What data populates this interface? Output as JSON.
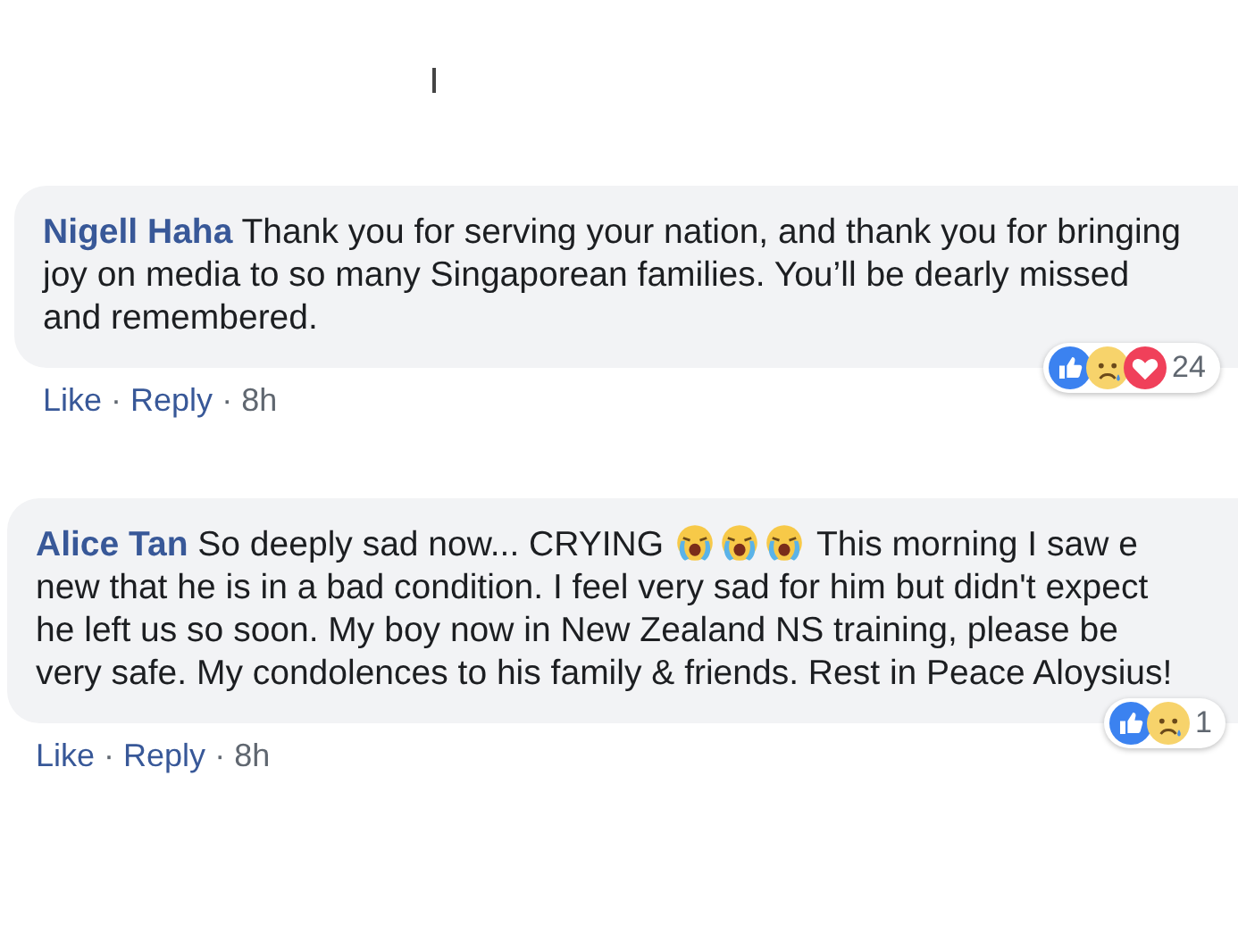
{
  "comments": [
    {
      "author": "Nigell Haha",
      "segments": [
        {
          "kind": "text",
          "text": "Thank you for serving your nation, and thank you for bringing joy on media to so many Singaporean families. You’ll be dearly missed and remembered."
        }
      ],
      "actions": [
        {
          "label": "Like"
        },
        {
          "label": "Reply"
        }
      ],
      "separator": "·",
      "time": "8h",
      "reactions": [
        {
          "kind": "like"
        },
        {
          "kind": "sad"
        },
        {
          "kind": "love"
        }
      ],
      "reaction_count": "24"
    },
    {
      "author": "Alice Tan",
      "segments": [
        {
          "kind": "text",
          "text": "So deeply sad now... CRYING"
        },
        {
          "kind": "crying"
        },
        {
          "kind": "crying"
        },
        {
          "kind": "crying"
        },
        {
          "kind": "text",
          "text": "This morning I saw e new that he is in a bad condition. I feel very sad for him but didn't expect he left us so soon. My boy now in New Zealand NS training, please be very safe. My condolences to his family & friends. Rest in Peace Aloysius!"
        }
      ],
      "actions": [
        {
          "label": "Like"
        },
        {
          "label": "Reply"
        }
      ],
      "separator": "·",
      "time": "8h",
      "reactions": [
        {
          "kind": "like"
        },
        {
          "kind": "sad"
        }
      ],
      "reaction_count": "1"
    }
  ]
}
